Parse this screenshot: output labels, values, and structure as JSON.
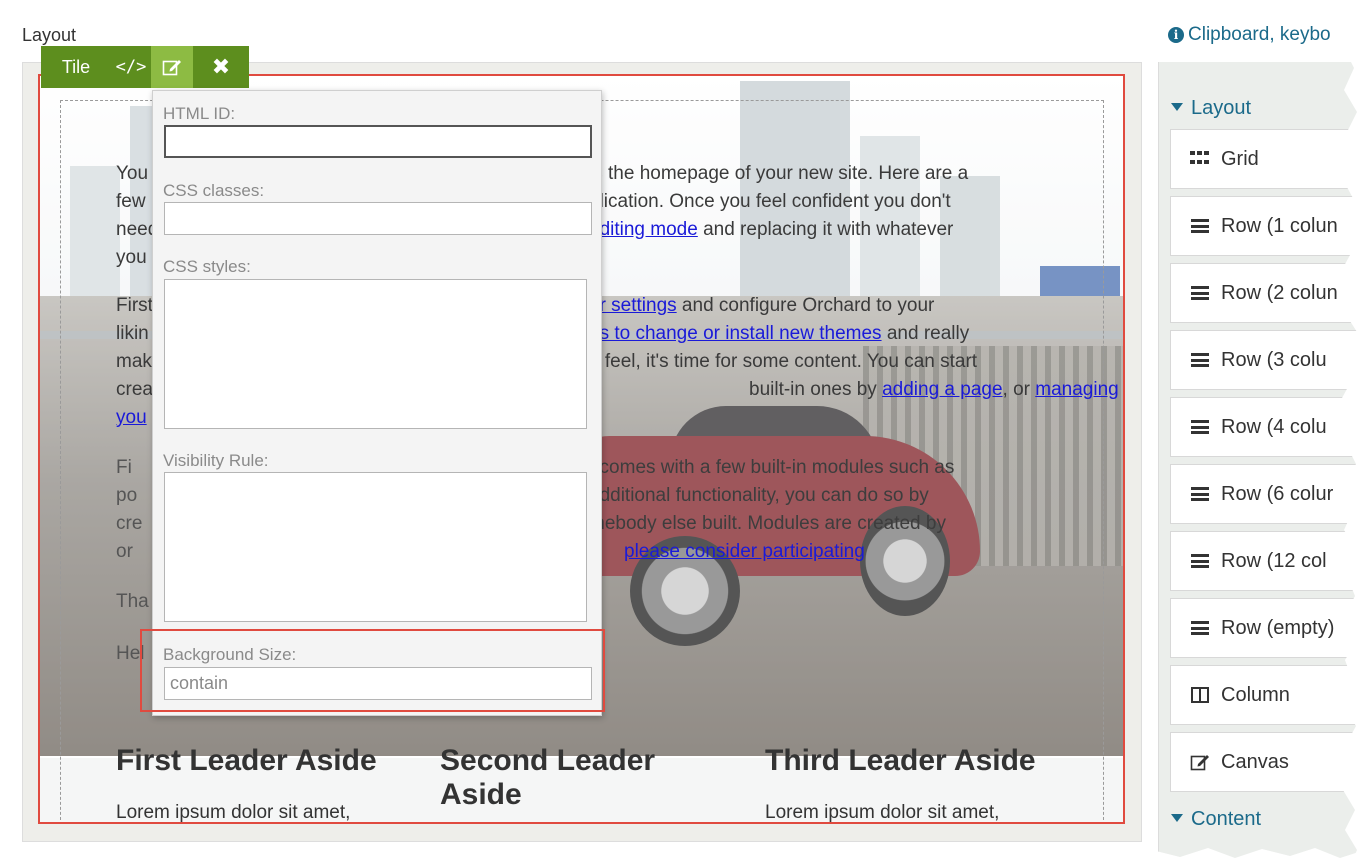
{
  "header": {
    "title": "Layout",
    "help_link": "Clipboard, keybo",
    "help_icon": "info-icon"
  },
  "toolbar": {
    "label": "Tile",
    "code_icon": "</>",
    "edit_icon": "edit-icon",
    "close_icon": "✖"
  },
  "content": {
    "p1": {
      "lines": [
        "You",
        "few",
        "need",
        "you"
      ],
      "right_lines": [
        "is the homepage of your new site. Here are a",
        "plication. Once you feel confident you don't",
        "and replacing it with whatever"
      ],
      "link_editing": "editing mode"
    },
    "p2": {
      "left": [
        "First",
        "likin",
        "make",
        "crea",
        "you"
      ],
      "link_settings": "ur settings",
      "after_settings": " and configure Orchard to your",
      "link_themes": "es to change or install new themes",
      "after_themes": " and really",
      "line3": "d feel, it's time for some content. You can start",
      "line4_pre": "built-in ones by ",
      "link_adding_page": "adding a page",
      "line4_mid": ", or ",
      "link_managing": "managing"
    },
    "p3": {
      "lines": [
        "t comes with a few built-in modules such as",
        "additional functionality, you can do so by",
        "mebody else built. Modules are created by"
      ],
      "link_participating": "please consider participating",
      "left": [
        "Fi",
        "po",
        "cre",
        "or"
      ]
    },
    "p4": {
      "left": "Tha"
    },
    "p5": {
      "left": "Hel"
    },
    "asides": [
      {
        "title": "First Leader Aside",
        "body": "Lorem ipsum dolor sit amet,"
      },
      {
        "title": "Second Leader Aside",
        "body": ""
      },
      {
        "title": "Third Leader Aside",
        "body": "Lorem ipsum dolor sit amet,"
      }
    ]
  },
  "popup": {
    "html_id_label": "HTML ID:",
    "html_id_value": "",
    "css_classes_label": "CSS classes:",
    "css_classes_value": "",
    "css_styles_label": "CSS styles:",
    "css_styles_value": "",
    "visibility_label": "Visibility Rule:",
    "visibility_value": "",
    "bg_size_label": "Background Size:",
    "bg_size_value": "contain"
  },
  "sidebar": {
    "layout_section": "Layout",
    "items": [
      {
        "label": "Grid",
        "icon": "grid-icon"
      },
      {
        "label": "Row (1 colun",
        "icon": "bars-icon"
      },
      {
        "label": "Row (2 colun",
        "icon": "bars-icon"
      },
      {
        "label": "Row (3 colu",
        "icon": "bars-icon"
      },
      {
        "label": "Row (4 colu",
        "icon": "bars-icon"
      },
      {
        "label": "Row (6 colur",
        "icon": "bars-icon"
      },
      {
        "label": "Row (12 col",
        "icon": "bars-icon"
      },
      {
        "label": "Row (empty)",
        "icon": "bars-icon"
      },
      {
        "label": "Column",
        "icon": "column-icon"
      },
      {
        "label": "Canvas",
        "icon": "edit-icon"
      }
    ],
    "content_section": "Content"
  },
  "colors": {
    "accent_green": "#5d8e1e",
    "active_green": "#8dbb43",
    "highlight_red": "#e04a3f",
    "link_blue": "#1b6a8a"
  }
}
